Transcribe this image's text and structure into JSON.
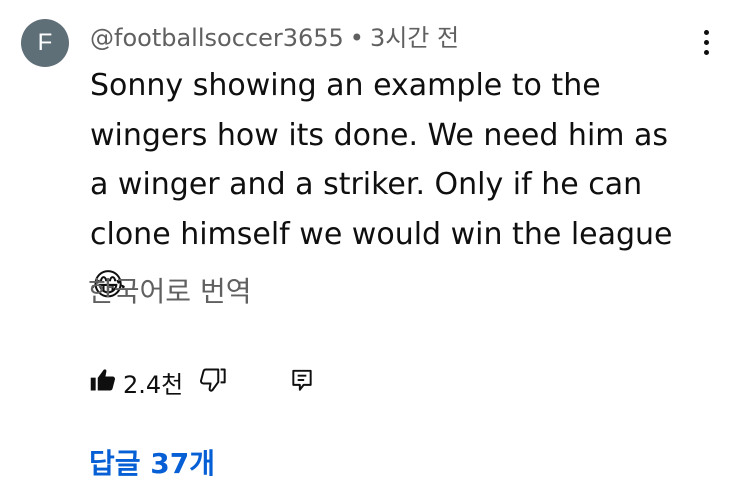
{
  "comment": {
    "avatar_letter": "F",
    "author": "@footballsoccer3655",
    "separator": "•",
    "time": "3시간 전",
    "text": "Sonny showing an example to the wingers how its done. We need him as a winger and a striker. Only if he can clone himself we would win the league",
    "emoji": "😂",
    "translate_label": "한국어로 번역",
    "like_count": "2.4천",
    "replies_label": "답글 37개"
  },
  "icons": {
    "like": "thumbs-up-filled-icon",
    "dislike": "thumbs-down-outline-icon",
    "reply": "comment-icon",
    "more": "more-vertical-icon"
  },
  "colors": {
    "avatar_bg": "#5f6f78",
    "meta_text": "#606060",
    "link": "#065fd4",
    "text": "#0f0f0f"
  }
}
